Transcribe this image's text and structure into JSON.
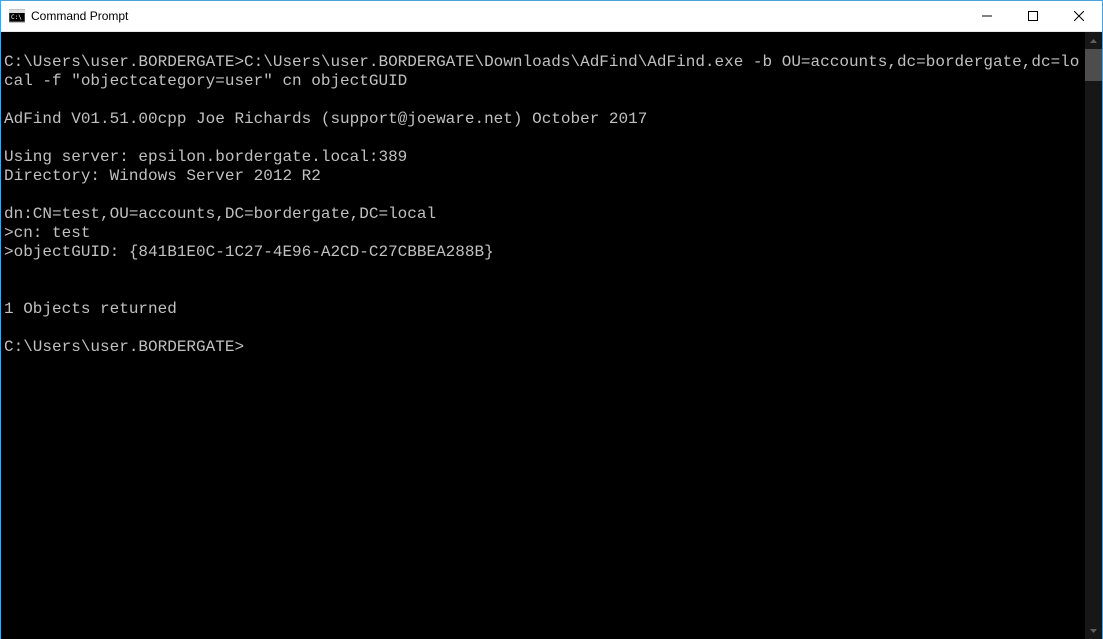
{
  "titlebar": {
    "title": "Command Prompt"
  },
  "terminal": {
    "lines": [
      "",
      "C:\\Users\\user.BORDERGATE>C:\\Users\\user.BORDERGATE\\Downloads\\AdFind\\AdFind.exe -b OU=accounts,dc=bordergate,dc=local -f \"objectcategory=user\" cn objectGUID",
      "",
      "AdFind V01.51.00cpp Joe Richards (support@joeware.net) October 2017",
      "",
      "Using server: epsilon.bordergate.local:389",
      "Directory: Windows Server 2012 R2",
      "",
      "dn:CN=test,OU=accounts,DC=bordergate,DC=local",
      ">cn: test",
      ">objectGUID: {841B1E0C-1C27-4E96-A2CD-C27CBBEA288B}",
      "",
      "",
      "1 Objects returned",
      "",
      "C:\\Users\\user.BORDERGATE>"
    ]
  }
}
